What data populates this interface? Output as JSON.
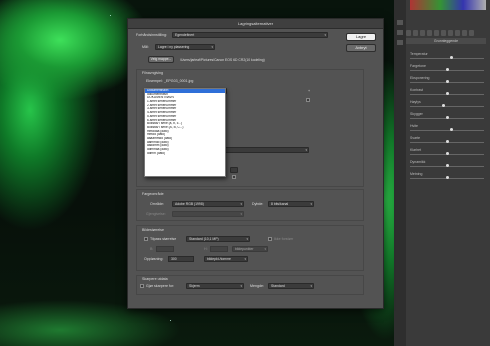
{
  "dialog": {
    "title": "Lagringsalternativer",
    "buttons": {
      "save": "Lagre",
      "cancel": "Avbryt"
    },
    "preset": {
      "label": "Forhåndsinnstilling:",
      "value": "Egendefinert"
    },
    "destination": {
      "section": "Mål:",
      "value": "Lagre i ny plassering",
      "choose_button": "Velg mappe...",
      "path": "/Users/jarleaf/Pictures/Canon EOS 6D CR2(10 kodeling)"
    },
    "file_naming": {
      "section": "Filnavngiving",
      "example_label": "Eksempel:",
      "example_value": "_EPG03_0001.jpg",
      "selected": "Dokumentnavn",
      "options": [
        "Dokumentnavn",
        "dokumentnavn",
        "DOKUMENTNAVN",
        "1-sifret serienummer",
        "2-sifret serienummer",
        "3-sifret serienummer",
        "4-sifret serienummer",
        "5-sifret serienummer",
        "6-sifret serienummer",
        "Bokstav i serie (a, b, c...)",
        "Bokstav i serie (A, B, C...)",
        "mmddåå (dato)",
        "mmdd (dato)",
        "ååååmmdd (dato)",
        "ååmmdd (dato)",
        "ååddmm (dato)",
        "ddmmåå (dato)",
        "ddmm (dato)"
      ]
    },
    "format": {
      "section": "Fargeområde",
      "space_label": "Område:",
      "space_value": "Adobe RGB (1998)",
      "depth_label": "Dybde:",
      "depth_value": "8 bits/kanal",
      "profile_label": "Gjengivelse:"
    },
    "image_size": {
      "section": "Bildestørrelse",
      "fit_label": "Tilpass størrelse",
      "fit_value": "Standard (10,1 MP)",
      "no_enlarge": "Ikke forstørr",
      "w_label": "B:",
      "h_label": "H:",
      "unit": "bildepunkter",
      "resolution_label": "Oppløsning:",
      "resolution_value": "300",
      "resolution_unit": "bildepkt./tomme"
    },
    "sharpen": {
      "section": "Skarpere utdata",
      "for_label": "Gjør skarpere for:",
      "for_value": "Skjerm",
      "amount_label": "Mengde:",
      "amount_value": "Standard"
    }
  },
  "panel": {
    "header": "Grunnleggende",
    "sliders": [
      {
        "label": "Temperatur",
        "level": 0.55
      },
      {
        "label": "Fargetone",
        "level": 0.5
      },
      {
        "label": "Eksponering",
        "level": 0.5
      },
      {
        "label": "Kontrast",
        "level": 0.5
      },
      {
        "label": "Høylys",
        "level": 0.45
      },
      {
        "label": "Skygger",
        "level": 0.5
      },
      {
        "label": "Hvite",
        "level": 0.55
      },
      {
        "label": "Svarte",
        "level": 0.5
      },
      {
        "label": "Klarhet",
        "level": 0.5
      },
      {
        "label": "Dynamikk",
        "level": 0.5
      },
      {
        "label": "Metning",
        "level": 0.5
      }
    ]
  }
}
